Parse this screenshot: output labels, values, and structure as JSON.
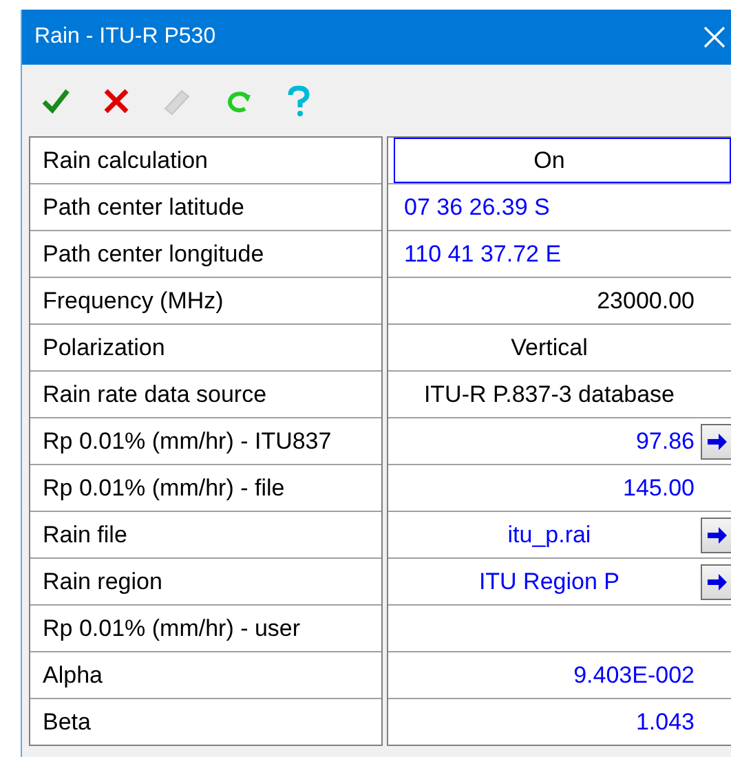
{
  "window": {
    "title": "Rain - ITU-R P530"
  },
  "toolbar": [
    {
      "kind": "ok",
      "disabled": false
    },
    {
      "kind": "cancel",
      "disabled": false
    },
    {
      "kind": "eraser",
      "disabled": true
    },
    {
      "kind": "refresh",
      "disabled": false
    },
    {
      "kind": "help",
      "disabled": false
    }
  ],
  "rows": [
    {
      "label": "Rain calculation",
      "value": "On",
      "kind": "center",
      "color": "#000000",
      "focused": true,
      "button": false
    },
    {
      "label": "Path center latitude",
      "value": "07 36 26.39 S",
      "kind": "left",
      "color": "#0000ff",
      "focused": false,
      "button": false
    },
    {
      "label": "Path center longitude",
      "value": "110 41 37.72 E",
      "kind": "left",
      "color": "#0000ff",
      "focused": false,
      "button": false
    },
    {
      "label": "Frequency (MHz)",
      "value": "23000.00",
      "kind": "right",
      "color": "#000000",
      "focused": false,
      "button": false
    },
    {
      "label": "Polarization",
      "value": "Vertical",
      "kind": "center",
      "color": "#000000",
      "focused": false,
      "button": false
    },
    {
      "label": "Rain rate data source",
      "value": "ITU-R P.837-3 database",
      "kind": "center",
      "color": "#000000",
      "focused": false,
      "button": false
    },
    {
      "label": "Rp 0.01% (mm/hr) - ITU837",
      "value": "97.86",
      "kind": "right",
      "color": "#0000ff",
      "focused": false,
      "button": true
    },
    {
      "label": "Rp 0.01% (mm/hr) - file",
      "value": "145.00",
      "kind": "right",
      "color": "#0000ff",
      "focused": false,
      "button": false
    },
    {
      "label": "Rain file",
      "value": "itu_p.rai",
      "kind": "center",
      "color": "#0000ff",
      "focused": false,
      "button": true
    },
    {
      "label": "Rain region",
      "value": "ITU Region P",
      "kind": "center",
      "color": "#0000ff",
      "focused": false,
      "button": true
    },
    {
      "label": "Rp 0.01% (mm/hr) - user",
      "focused": false,
      "button": false
    },
    {
      "label": "Alpha",
      "value": "9.403E-002",
      "kind": "right",
      "color": "#0000ff",
      "focused": false,
      "button": false
    },
    {
      "label": "Beta",
      "value": "1.043",
      "kind": "right",
      "color": "#0000ff",
      "focused": false,
      "button": false
    }
  ]
}
